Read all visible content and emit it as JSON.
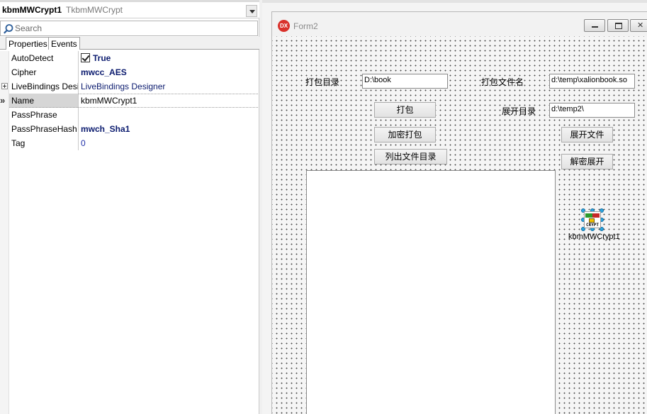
{
  "inspector": {
    "component_name": "kbmMWCrypt1",
    "component_type": "TkbmMWCrypt",
    "search_placeholder": "Search",
    "tabs": [
      "Properties",
      "Events"
    ],
    "properties": [
      {
        "name": "AutoDetect",
        "value": "True",
        "checked": true
      },
      {
        "name": "Cipher",
        "value": "mwcc_AES"
      },
      {
        "name": "LiveBindings Designer",
        "value": "LiveBindings Designer",
        "expandable": true
      },
      {
        "name": "Name",
        "value": "kbmMWCrypt1",
        "selected": true
      },
      {
        "name": "PassPhrase",
        "value": ""
      },
      {
        "name": "PassPhraseHash",
        "value": "mwch_Sha1"
      },
      {
        "name": "Tag",
        "value": "0"
      }
    ]
  },
  "form": {
    "icon_text": "DX",
    "title": "Form2",
    "labels": {
      "pack_dir": "打包目录",
      "pack_file": "打包文件名",
      "extract_dir": "展开目录"
    },
    "edits": {
      "pack_dir": "D:\\book",
      "pack_file": "d:\\temp\\xalionbook.so",
      "extract_dir": "d:\\temp2\\"
    },
    "buttons": {
      "pack": "打包",
      "encrypt_pack": "加密打包",
      "list_files": "列出文件目录",
      "extract_file": "展开文件",
      "decrypt_extract": "解密展开"
    },
    "component": {
      "caption": "kbmMWCrypt1",
      "icon_top_text": "OBE",
      "icon_word": "CRYPT"
    }
  }
}
